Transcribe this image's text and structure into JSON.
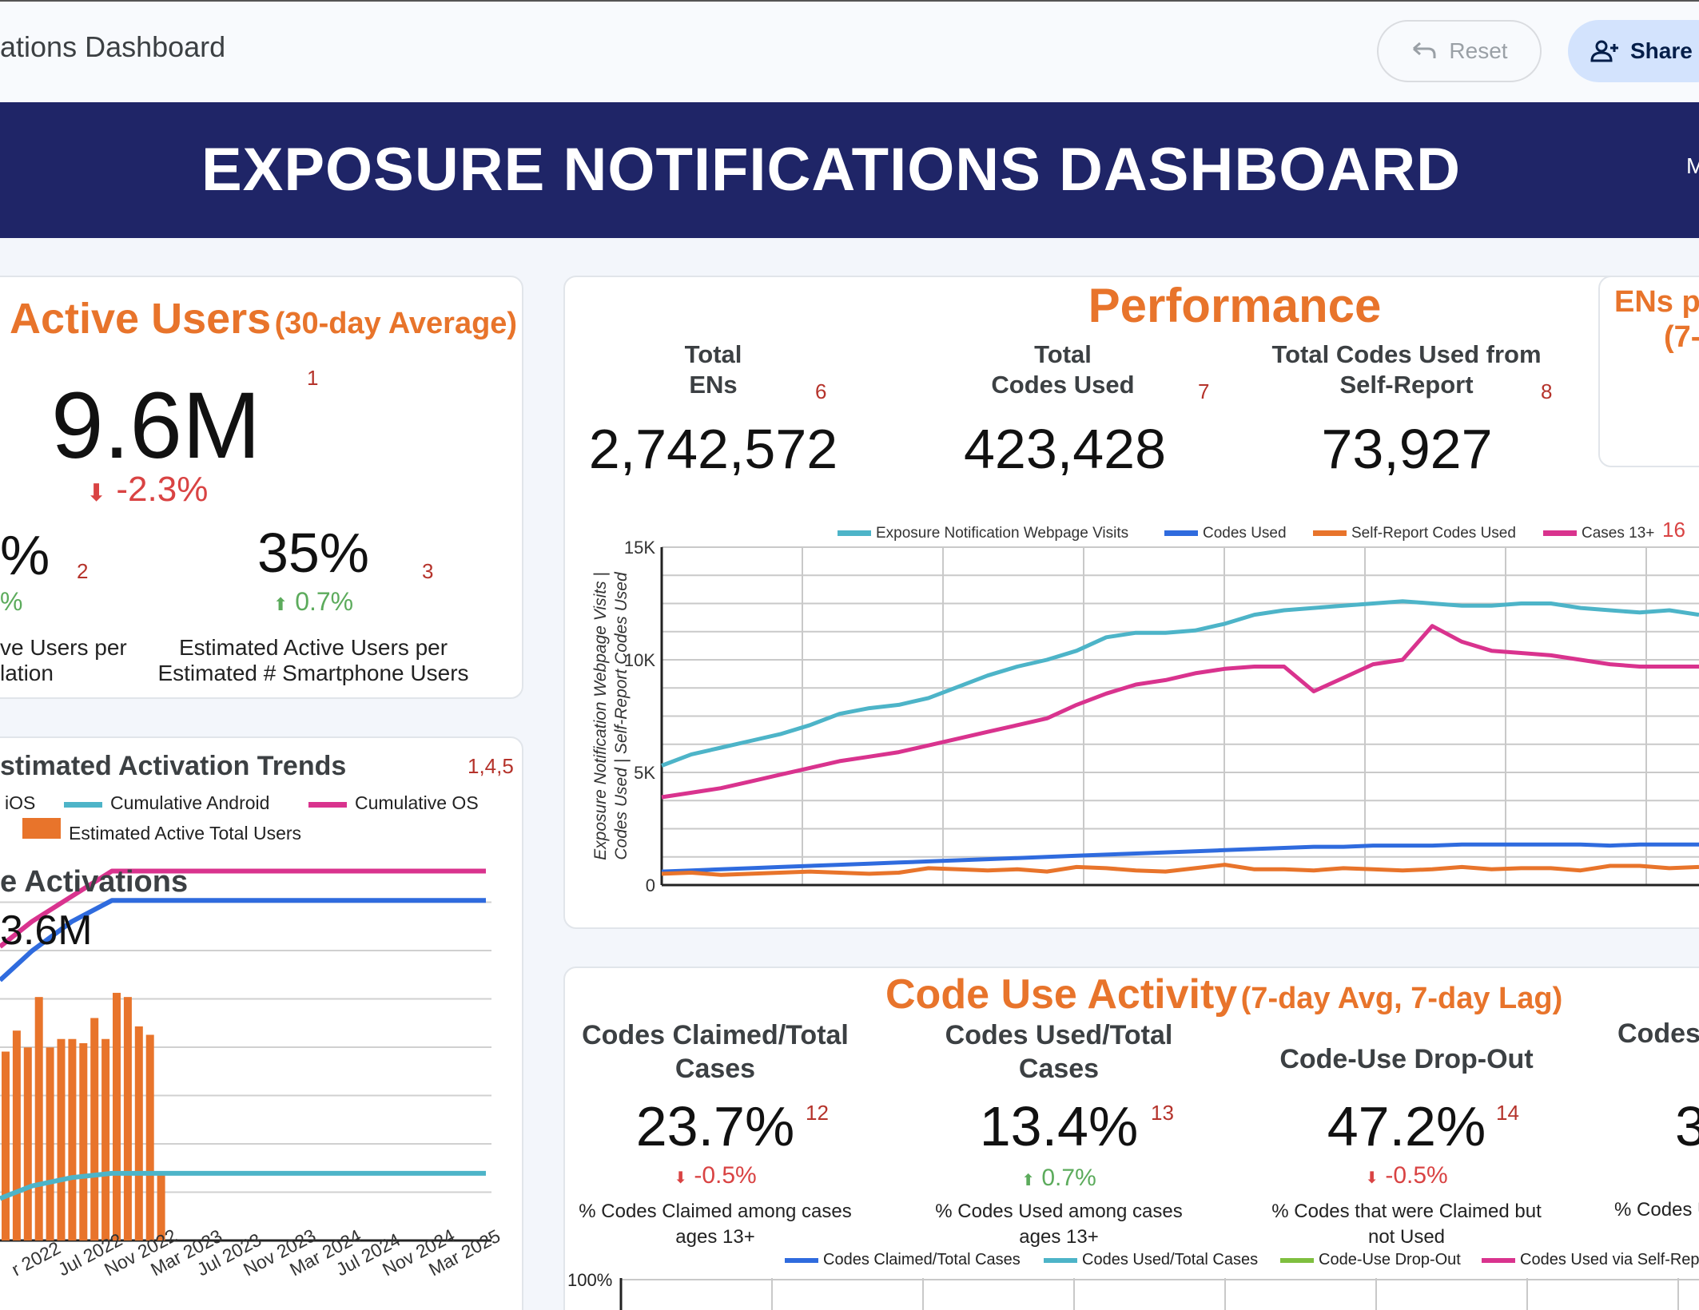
{
  "app": {
    "title": "ations Dashboard",
    "reset_label": "Reset",
    "share_label": "Share"
  },
  "banner": {
    "title": "EXPOSURE NOTIFICATIONS DASHBOARD",
    "edge_text": "M"
  },
  "active_users": {
    "title": "Active Users",
    "subtitle": "(30-day Average)",
    "value": "9.6M",
    "note": "1",
    "change": "-2.3%",
    "left_metric": {
      "value": "%",
      "change": "%",
      "note": "2",
      "caption_line1": "ve Users per",
      "caption_line2": "lation"
    },
    "right_metric": {
      "value": "35%",
      "change": "0.7%",
      "note": "3",
      "caption_line1": "Estimated Active Users per",
      "caption_line2": "Estimated # Smartphone Users"
    }
  },
  "trends": {
    "title": "stimated Activation Trends",
    "note": "1,4,5",
    "legend": [
      "iOS",
      "Cumulative Android",
      "Cumulative OS",
      "Estimated Active Total Users"
    ],
    "overlay_title": "e Activations",
    "overlay_value": "3.6M",
    "x_labels": [
      "r 2022",
      "Jul 2022",
      "Nov 2022",
      "Mar 2023",
      "Jul 2023",
      "Nov 2023",
      "Mar 2024",
      "Jul 2024",
      "Nov 2024",
      "Mar 2025"
    ]
  },
  "performance": {
    "title": "Performance",
    "metrics": [
      {
        "label_line1": "Total",
        "label_line2": "ENs",
        "value": "2,742,572",
        "note": "6"
      },
      {
        "label_line1": "Total",
        "label_line2": "Codes Used",
        "value": "423,428",
        "note": "7"
      },
      {
        "label_line1": "Total Codes Used from",
        "label_line2": "Self-Report",
        "value": "73,927",
        "note": "8"
      }
    ],
    "note_16": "16"
  },
  "ens_card": {
    "line1": "ENs pe",
    "line2": "(7-"
  },
  "code_use": {
    "title": "Code Use Activity",
    "subtitle": "(7-day Avg, 7-day Lag)",
    "metrics": [
      {
        "label_line1": "Codes Claimed/Total",
        "label_line2": "Cases",
        "value": "23.7%",
        "note": "12",
        "change": "-0.5%",
        "caption_line1": "% Codes Claimed among cases",
        "caption_line2": "ages 13+"
      },
      {
        "label_line1": "Codes Used/Total",
        "label_line2": "Cases",
        "value": "13.4%",
        "note": "13",
        "change": "0.7%",
        "caption_line1": "% Codes Used among cases",
        "caption_line2": "ages 13+"
      },
      {
        "label_line1": "Code-Use Drop-Out",
        "label_line2": "",
        "value": "47.2%",
        "note": "14",
        "change": "-0.5%",
        "caption_line1": "% Codes that were Claimed but",
        "caption_line2": "not Used"
      },
      {
        "label_line1": "Codes",
        "label_line2": "",
        "value": "3",
        "note": "",
        "change": "",
        "caption_line1": "% Codes U",
        "caption_line2": ""
      }
    ],
    "legend": [
      "Codes Claimed/Total Cases",
      "Codes Used/Total Cases",
      "Code-Use Drop-Out",
      "Codes Used via Self-Repo"
    ],
    "y_label": "100%"
  },
  "colors": {
    "teal": "#4db4c8",
    "blue": "#2f6bde",
    "orange": "#e8742b",
    "magenta": "#d9338e",
    "green": "#7fbf3f",
    "navy": "#1f2567"
  },
  "chart_data": [
    {
      "type": "line",
      "ylabel": "Exposure Notification Webpage Visits | Codes Used | Self-Report Codes Used",
      "ylim": [
        0,
        15000
      ],
      "y_ticks": [
        "0",
        "5K",
        "10K",
        "15K"
      ],
      "y_tick_values": [
        0,
        5000,
        10000,
        15000
      ],
      "grid": true,
      "legend_position": "top",
      "series": [
        {
          "name": "Exposure Notification Webpage Visits",
          "color": "#4db4c8",
          "values": [
            5300,
            5800,
            6100,
            6400,
            6700,
            7100,
            7600,
            7850,
            8000,
            8300,
            8800,
            9300,
            9700,
            10000,
            10400,
            11000,
            11200,
            11200,
            11300,
            11600,
            12000,
            12200,
            12300,
            12400,
            12500,
            12600,
            12500,
            12400,
            12400,
            12500,
            12500,
            12300,
            12200,
            12100,
            12200,
            12000
          ]
        },
        {
          "name": "Codes Used",
          "color": "#2f6bde",
          "values": [
            600,
            650,
            700,
            750,
            800,
            850,
            900,
            950,
            1000,
            1050,
            1100,
            1150,
            1200,
            1250,
            1300,
            1350,
            1400,
            1450,
            1500,
            1550,
            1600,
            1650,
            1700,
            1700,
            1750,
            1750,
            1750,
            1800,
            1800,
            1800,
            1800,
            1800,
            1750,
            1800,
            1800,
            1800
          ]
        },
        {
          "name": "Self-Report Codes Used",
          "color": "#e8742b",
          "values": [
            500,
            550,
            450,
            500,
            550,
            600,
            550,
            500,
            550,
            750,
            700,
            650,
            700,
            600,
            800,
            750,
            650,
            600,
            750,
            900,
            700,
            700,
            650,
            750,
            700,
            650,
            700,
            800,
            700,
            750,
            750,
            650,
            850,
            850,
            750,
            800
          ]
        },
        {
          "name": "Cases 13+",
          "color": "#d9338e",
          "values": [
            3900,
            4100,
            4300,
            4600,
            4900,
            5200,
            5500,
            5700,
            5900,
            6200,
            6500,
            6800,
            7100,
            7400,
            8000,
            8500,
            8900,
            9100,
            9400,
            9600,
            9700,
            9700,
            8600,
            9200,
            9800,
            10000,
            11500,
            10800,
            10400,
            10300,
            10200,
            10000,
            9800,
            9700,
            9700,
            9700
          ]
        }
      ]
    },
    {
      "type": "bar",
      "series": [
        {
          "name": "Estimated Active Total Users",
          "color": "#e8742b",
          "values": [
            4.5,
            5.0,
            4.6,
            5.8,
            4.6,
            4.8,
            4.8,
            4.7,
            5.3,
            4.8,
            5.9,
            5.8,
            5.1,
            4.9,
            1.6
          ]
        },
        {
          "name": "Cumulative OS",
          "color": "#d9338e",
          "values": [
            7.0,
            7.6,
            8.2,
            8.8,
            8.8,
            8.8,
            8.8,
            8.8,
            8.8,
            8.8
          ]
        },
        {
          "name": "Cumulative Android",
          "color": "#2f6bde",
          "values": [
            6.2,
            6.9,
            7.6,
            8.1,
            8.1,
            8.1,
            8.1,
            8.1,
            8.1,
            8.1
          ]
        },
        {
          "name": "iOS",
          "color": "#4db4c8",
          "values": [
            1.0,
            1.3,
            1.5,
            1.6,
            1.6,
            1.6,
            1.6,
            1.6,
            1.6,
            1.6
          ]
        }
      ]
    }
  ]
}
